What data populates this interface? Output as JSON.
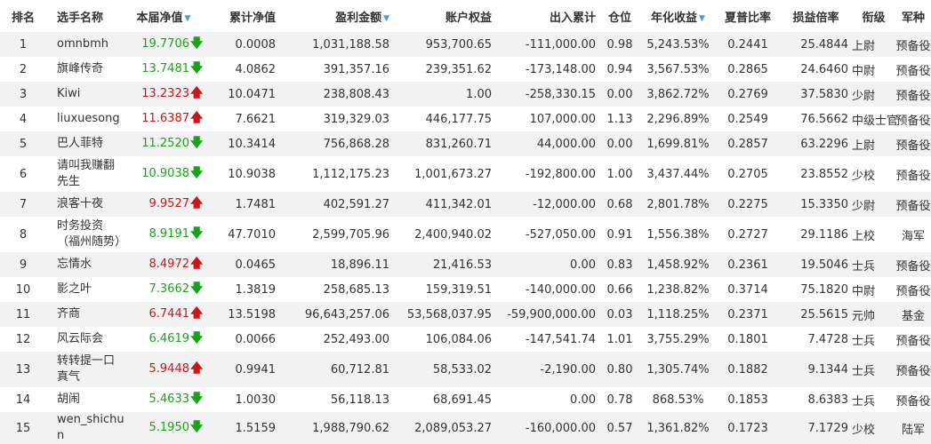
{
  "headers": {
    "rank": "排名",
    "name": "选手名称",
    "nav": "本届净值",
    "cum_nav": "累计净值",
    "profit": "盈利金额",
    "equity": "账户权益",
    "flow": "出入累计",
    "position": "仓位",
    "annual": "年化收益",
    "sharpe": "夏普比率",
    "pl_ratio": "损益倍率",
    "rank_title": "衔级",
    "branch": "军种"
  },
  "sort_icon": "▼",
  "arrow_up_icon": "🡅",
  "arrow_down_icon": "🡇",
  "colors": {
    "up": "#c8161d",
    "down": "#1aa31a",
    "sort": "#3aa0e0",
    "stripe": "#f2f2f2"
  },
  "rows": [
    {
      "rank": "1",
      "name": "omnbmh",
      "nav": "19.7706",
      "dir": "down",
      "cum_nav": "0.0008",
      "profit": "1,031,188.58",
      "equity": "953,700.65",
      "flow": "-111,000.00",
      "position": "0.98",
      "annual": "5,243.53%",
      "sharpe": "0.2441",
      "pl_ratio": "25.4844",
      "rank_title": "上尉",
      "branch": "预备役"
    },
    {
      "rank": "2",
      "name": "旗峰传奇",
      "nav": "13.7481",
      "dir": "down",
      "cum_nav": "4.0862",
      "profit": "391,357.16",
      "equity": "239,351.62",
      "flow": "-173,148.00",
      "position": "0.94",
      "annual": "3,567.53%",
      "sharpe": "0.2865",
      "pl_ratio": "24.6460",
      "rank_title": "中尉",
      "branch": "预备役"
    },
    {
      "rank": "3",
      "name": "Kiwi",
      "nav": "13.2323",
      "dir": "up",
      "cum_nav": "10.0471",
      "profit": "238,808.43",
      "equity": "1.00",
      "flow": "-258,330.15",
      "position": "0.00",
      "annual": "3,862.72%",
      "sharpe": "0.2769",
      "pl_ratio": "37.5830",
      "rank_title": "少尉",
      "branch": "预备役"
    },
    {
      "rank": "4",
      "name": "liuxuesong",
      "nav": "11.6387",
      "dir": "up",
      "cum_nav": "7.6621",
      "profit": "319,329.03",
      "equity": "446,177.75",
      "flow": "107,000.00",
      "position": "1.13",
      "annual": "2,296.89%",
      "sharpe": "0.2549",
      "pl_ratio": "76.5662",
      "rank_title": "中级士官",
      "branch": "预备役"
    },
    {
      "rank": "5",
      "name": "巴人菲特",
      "nav": "11.2520",
      "dir": "down",
      "cum_nav": "10.3414",
      "profit": "756,868.28",
      "equity": "831,260.71",
      "flow": "44,000.00",
      "position": "0.00",
      "annual": "1,699.81%",
      "sharpe": "0.2857",
      "pl_ratio": "63.2296",
      "rank_title": "上尉",
      "branch": "预备役"
    },
    {
      "rank": "6",
      "name": "请叫我赚翻先生",
      "nav": "10.9038",
      "dir": "down",
      "cum_nav": "10.9038",
      "profit": "1,112,175.23",
      "equity": "1,001,673.27",
      "flow": "-192,800.00",
      "position": "1.00",
      "annual": "3,437.44%",
      "sharpe": "0.2705",
      "pl_ratio": "23.8552",
      "rank_title": "少校",
      "branch": "预备役"
    },
    {
      "rank": "7",
      "name": "浪客十夜",
      "nav": "9.9527",
      "dir": "up",
      "cum_nav": "1.7481",
      "profit": "402,591.27",
      "equity": "411,342.01",
      "flow": "-12,000.00",
      "position": "0.68",
      "annual": "2,801.78%",
      "sharpe": "0.2275",
      "pl_ratio": "15.3350",
      "rank_title": "少尉",
      "branch": "预备役"
    },
    {
      "rank": "8",
      "name": "时务投资（福州随势）",
      "nav": "8.9191",
      "dir": "down",
      "cum_nav": "47.7010",
      "profit": "2,599,705.96",
      "equity": "2,400,940.02",
      "flow": "-527,050.00",
      "position": "0.91",
      "annual": "1,556.38%",
      "sharpe": "0.2727",
      "pl_ratio": "29.1186",
      "rank_title": "上校",
      "branch": "海军"
    },
    {
      "rank": "9",
      "name": "忘情水",
      "nav": "8.4972",
      "dir": "up",
      "cum_nav": "0.0465",
      "profit": "18,896.11",
      "equity": "21,416.53",
      "flow": "0.00",
      "position": "0.83",
      "annual": "1,458.92%",
      "sharpe": "0.2361",
      "pl_ratio": "19.5046",
      "rank_title": "士兵",
      "branch": "预备役"
    },
    {
      "rank": "10",
      "name": "影之叶",
      "nav": "7.3662",
      "dir": "down",
      "cum_nav": "1.3819",
      "profit": "258,685.13",
      "equity": "159,319.51",
      "flow": "-140,000.00",
      "position": "0.66",
      "annual": "1,238.82%",
      "sharpe": "0.3714",
      "pl_ratio": "75.1820",
      "rank_title": "中尉",
      "branch": "预备役"
    },
    {
      "rank": "11",
      "name": "齐商",
      "nav": "6.7441",
      "dir": "up",
      "cum_nav": "13.5198",
      "profit": "96,643,257.06",
      "equity": "53,568,037.95",
      "flow": "-59,900,000.00",
      "position": "0.03",
      "annual": "1,118.25%",
      "sharpe": "0.2371",
      "pl_ratio": "25.5615",
      "rank_title": "元帅",
      "branch": "基金"
    },
    {
      "rank": "12",
      "name": "风云际会",
      "nav": "6.4619",
      "dir": "down",
      "cum_nav": "0.0066",
      "profit": "252,493.00",
      "equity": "106,084.06",
      "flow": "-147,541.74",
      "position": "1.01",
      "annual": "3,755.29%",
      "sharpe": "0.1801",
      "pl_ratio": "7.4728",
      "rank_title": "士兵",
      "branch": "预备役"
    },
    {
      "rank": "13",
      "name": "转转提一口真气",
      "nav": "5.9448",
      "dir": "up",
      "cum_nav": "0.9941",
      "profit": "60,712.81",
      "equity": "58,533.02",
      "flow": "-2,190.00",
      "position": "0.80",
      "annual": "1,305.74%",
      "sharpe": "0.1882",
      "pl_ratio": "9.1344",
      "rank_title": "士兵",
      "branch": "预备役"
    },
    {
      "rank": "14",
      "name": "胡闹",
      "nav": "5.4633",
      "dir": "down",
      "cum_nav": "1.0030",
      "profit": "56,118.13",
      "equity": "68,691.45",
      "flow": "0.00",
      "position": "0.78",
      "annual": "868.53%",
      "sharpe": "0.1853",
      "pl_ratio": "8.6383",
      "rank_title": "士兵",
      "branch": "预备役"
    },
    {
      "rank": "15",
      "name": "wen_shichun",
      "nav": "5.1950",
      "dir": "down",
      "cum_nav": "1.5159",
      "profit": "1,988,790.62",
      "equity": "2,089,053.27",
      "flow": "-160,000.00",
      "position": "0.57",
      "annual": "1,361.82%",
      "sharpe": "0.1723",
      "pl_ratio": "7.1729",
      "rank_title": "少校",
      "branch": "陆军"
    }
  ]
}
